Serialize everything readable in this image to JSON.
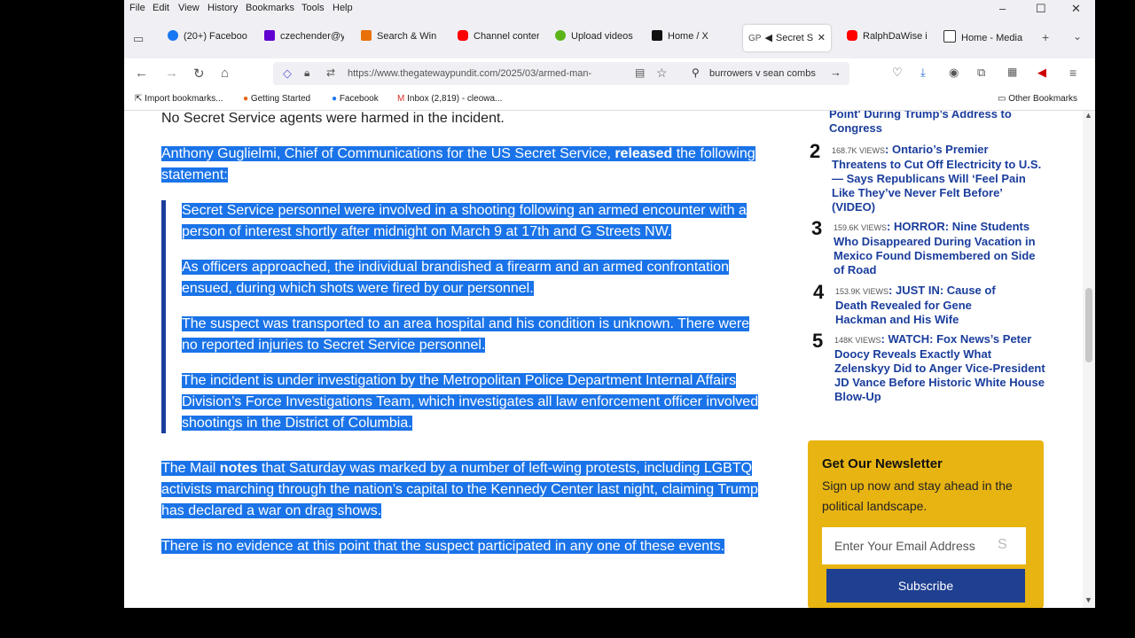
{
  "menu": {
    "items": [
      "File",
      "Edit",
      "View",
      "History",
      "Bookmarks",
      "Tools",
      "Help"
    ]
  },
  "tabs": [
    {
      "label": "(20+) Facebook",
      "icon_color": "#1877f2"
    },
    {
      "label": "czechender@y",
      "icon_color": "#6001d2"
    },
    {
      "label": "Search & Win",
      "icon_color": "#e8710a"
    },
    {
      "label": "Channel conter",
      "icon_color": "#ff0000"
    },
    {
      "label": "Upload videos",
      "icon_color": "#5bb318"
    },
    {
      "label": "Home / X",
      "icon_color": "#111111"
    },
    {
      "label": "Secret S",
      "icon_color": "#555555"
    },
    {
      "label": "RalphDaWise i",
      "icon_color": "#ff0000"
    },
    {
      "label": "Home - Media",
      "icon_color": "#333333"
    }
  ],
  "nav": {
    "url": "https://www.thegatewaypundit.com/2025/03/armed-man-",
    "search_value": "burrowers v sean combs"
  },
  "bookmarks": {
    "items": [
      "Import bookmarks...",
      "Getting Started",
      "Facebook",
      "Inbox (2,819) - cleowa..."
    ],
    "other": "Other Bookmarks"
  },
  "article": {
    "p0": "No Secret Service agents were harmed in the incident.",
    "p1_a": "Anthony Guglielmi, Chief of Communications for the US Secret Service, ",
    "p1_b": "released",
    "p1_c": " the following statement:",
    "q1": "Secret Service personnel were involved in a shooting following an armed encounter with a person of interest shortly after midnight on March 9 at 17th and G Streets NW.",
    "q2": "As officers approached, the individual brandished a firearm and an armed confrontation ensued, during which shots were fired by our personnel.",
    "q3": "The suspect was transported to an area hospital and his condition is unknown. There were no reported injuries to Secret Service personnel.",
    "q4": "The incident is under investigation by the Metropolitan Police Department Internal Affairs Division’s Force Investigations Team, which investigates all law enforcement officer involved shootings in the District of Columbia.",
    "p2_a": "The Mail ",
    "p2_b": "notes",
    "p2_c": " that Saturday was marked by a number of left-wing protests, including LGBTQ activists marching through the nation’s capital to the Kennedy Center last night, claiming Trump has declared a war on drag shows.",
    "p3": "There is no evidence at this point that the suspect participated in any one of these events."
  },
  "sidebar": {
    "top_title": "Point' During Trump’s Address to Congress",
    "items": [
      {
        "rank": "2",
        "views": "168.7K VIEWS",
        "sep": ": ",
        "title": "Ontario’s Premier Threatens to Cut Off Electricity to U.S. — Says Republicans Will ‘Feel Pain Like They’ve Never Felt Before’ (VIDEO)"
      },
      {
        "rank": "3",
        "views": "159.6K VIEWS",
        "sep": ": ",
        "title": "HORROR: Nine Students Who Disappeared During Vacation in Mexico Found Dismembered on Side of Road"
      },
      {
        "rank": "4",
        "views": "153.9K VIEWS",
        "sep": ": ",
        "title": "JUST IN: Cause of Death Revealed for Gene Hackman and His Wife"
      },
      {
        "rank": "5",
        "views": "148K VIEWS",
        "sep": ": ",
        "title": "WATCH: Fox News’s Peter Doocy Reveals Exactly What Zelenskyy Did to Anger Vice-President JD Vance Before Historic White House Blow-Up"
      }
    ]
  },
  "newsletter": {
    "title": "Get Our Newsletter",
    "subtitle": "Sign up now and stay ahead in the political landscape.",
    "placeholder": "Enter Your Email Address",
    "button": "Subscribe"
  }
}
